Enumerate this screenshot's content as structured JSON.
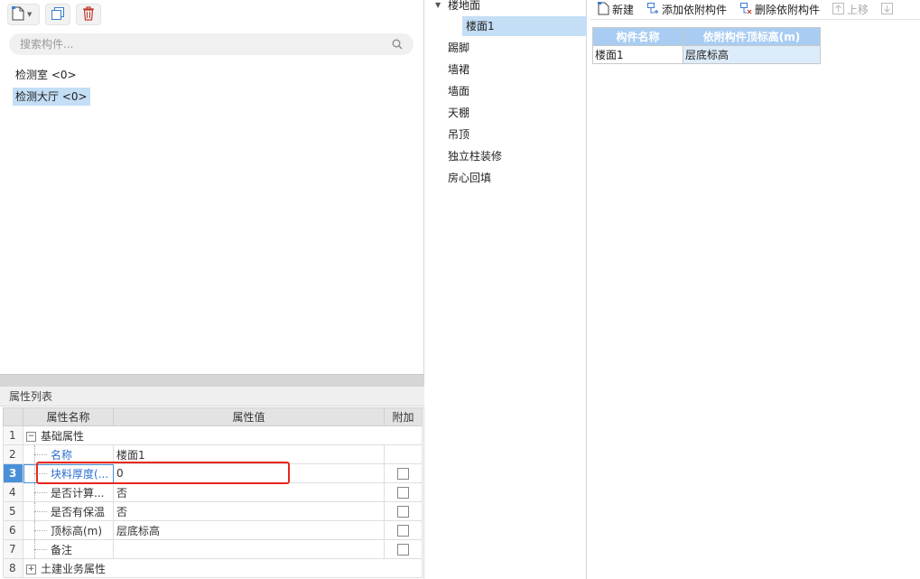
{
  "left_panel": {
    "search_placeholder": "搜索构件...",
    "tree_items": [
      {
        "label": "检测室 <0>",
        "selected": false
      },
      {
        "label": "检测大厅 <0>",
        "selected": true
      }
    ],
    "prop_list_title": "属性列表",
    "prop_headers": {
      "name": "属性名称",
      "value": "属性值",
      "extra": "附加"
    },
    "prop_rows": [
      {
        "num": "1",
        "name": "基础属性",
        "value": "",
        "expander": "−"
      },
      {
        "num": "2",
        "name": "名称",
        "value": "楼面1"
      },
      {
        "num": "3",
        "name": "块料厚度(...",
        "value": "0"
      },
      {
        "num": "4",
        "name": "是否计算...",
        "value": "否"
      },
      {
        "num": "5",
        "name": "是否有保温",
        "value": "否"
      },
      {
        "num": "6",
        "name": "顶标高(m)",
        "value": "层底标高"
      },
      {
        "num": "7",
        "name": "备注",
        "value": ""
      },
      {
        "num": "8",
        "name": "土建业务属性",
        "value": "",
        "expander": "+"
      }
    ]
  },
  "middle_panel": {
    "items": [
      {
        "label": "楼地面"
      },
      {
        "label": "楼面1"
      },
      {
        "label": "踢脚"
      },
      {
        "label": "墙裙"
      },
      {
        "label": "墙面"
      },
      {
        "label": "天棚"
      },
      {
        "label": "吊顶"
      },
      {
        "label": "独立柱装修"
      },
      {
        "label": "房心回填"
      }
    ]
  },
  "right_panel": {
    "toolbar": {
      "new": "新建",
      "add_attached": "添加依附构件",
      "delete_attached": "删除依附构件",
      "move_up": "上移"
    },
    "table": {
      "headers": [
        "构件名称",
        "依附构件顶标高(m)"
      ],
      "rows": [
        [
          "楼面1",
          "层底标高"
        ]
      ]
    }
  },
  "colors": {
    "selection": "#c4def5",
    "header_blue": "#a9cdf2",
    "highlight_red": "#e8271d",
    "current_row": "#4a90d9",
    "link_blue": "#2e6fd0"
  }
}
